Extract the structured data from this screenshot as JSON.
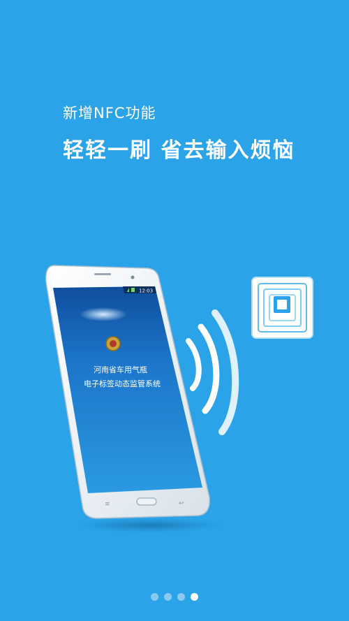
{
  "intro": {
    "subtitle": "新增NFC功能",
    "title": "轻轻一刷 省去输入烦恼"
  },
  "phone": {
    "status_time": "12:03",
    "app_title_line1": "河南省车用气瓶",
    "app_title_line2": "电子标签动态监管系统"
  },
  "pager": {
    "count": 4,
    "active_index": 3
  },
  "colors": {
    "background": "#2aa3e8",
    "wave": "#ffffff",
    "dot_inactive": "#8ac9f2",
    "dot_active": "#ffffff"
  }
}
